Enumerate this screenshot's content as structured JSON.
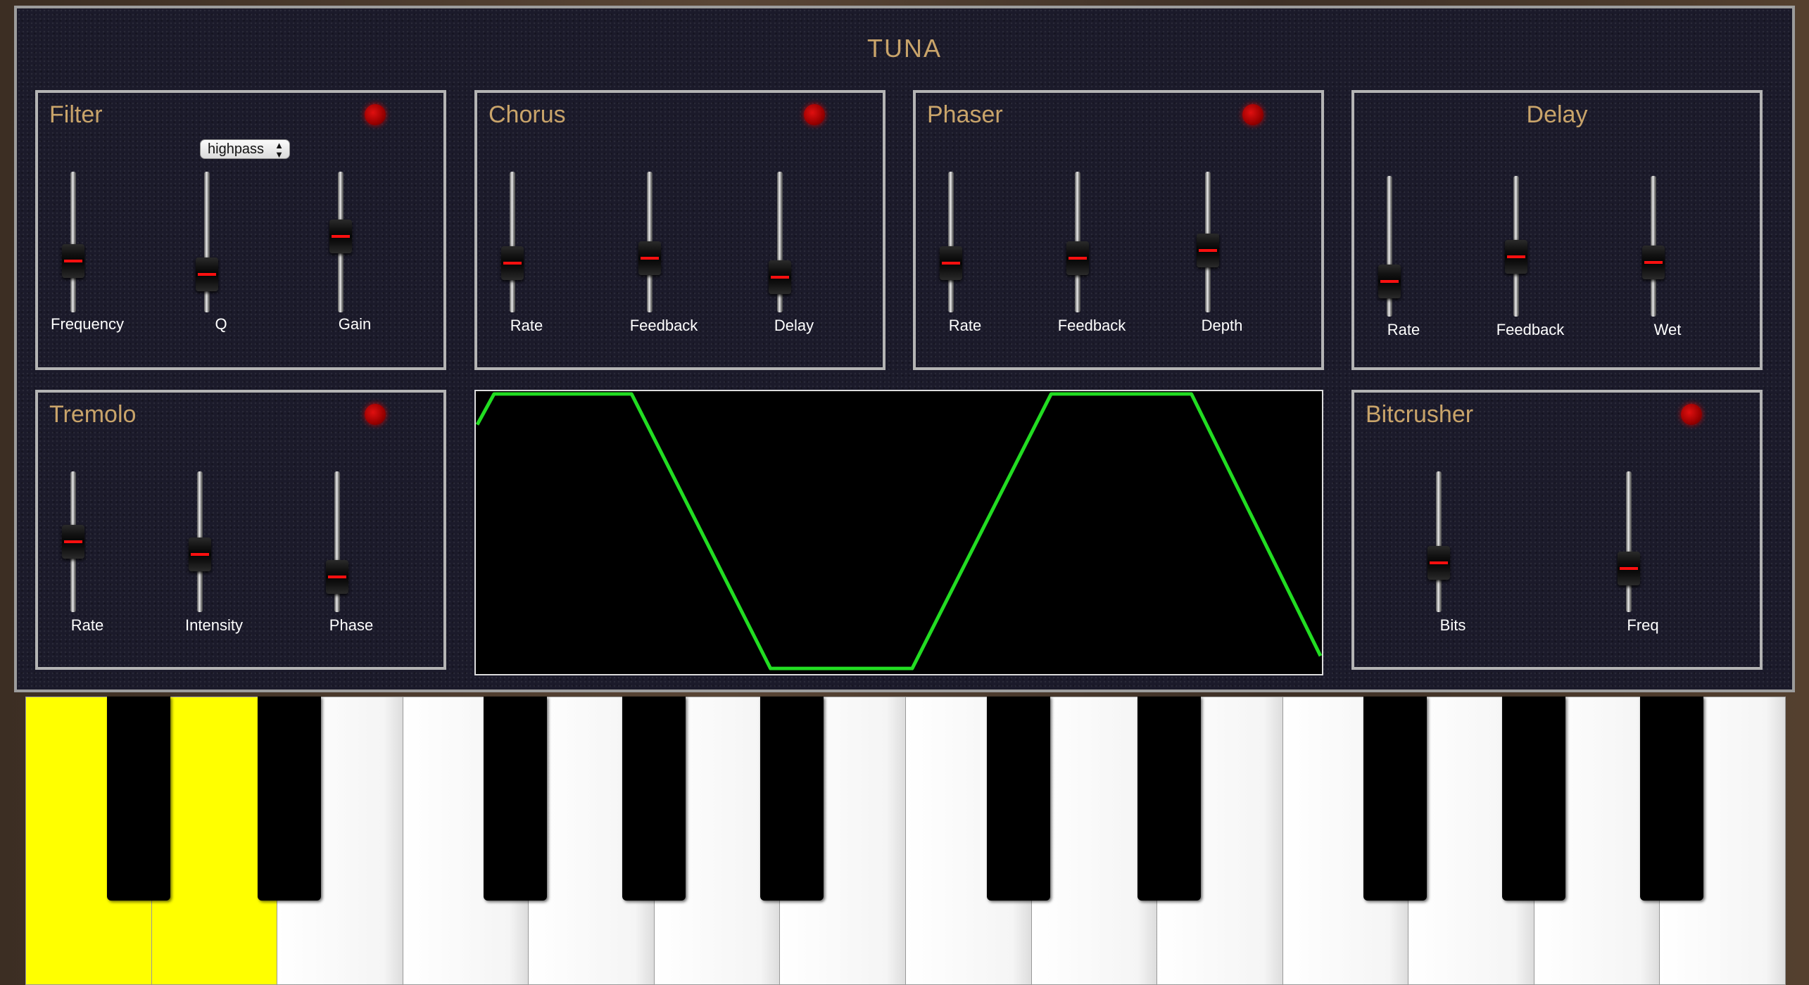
{
  "app": {
    "title": "TUNA"
  },
  "colors": {
    "panel_title": "#c9a46a",
    "led": "#d00000",
    "scope_line": "#22dd22",
    "active_key": "#ffff00"
  },
  "filter": {
    "title": "Filter",
    "type_select": {
      "value": "highpass"
    },
    "sliders": [
      {
        "label": "Frequency",
        "level": 0.32
      },
      {
        "label": "Q",
        "level": 0.2
      },
      {
        "label": "Gain",
        "level": 0.55
      }
    ]
  },
  "chorus": {
    "title": "Chorus",
    "sliders": [
      {
        "label": "Rate",
        "level": 0.3
      },
      {
        "label": "Feedback",
        "level": 0.35
      },
      {
        "label": "Delay",
        "level": 0.17
      }
    ]
  },
  "phaser": {
    "title": "Phaser",
    "sliders": [
      {
        "label": "Rate",
        "level": 0.3
      },
      {
        "label": "Feedback",
        "level": 0.35
      },
      {
        "label": "Depth",
        "level": 0.42
      }
    ]
  },
  "delay": {
    "title": "Delay",
    "sliders": [
      {
        "label": "Rate",
        "level": 0.17
      },
      {
        "label": "Feedback",
        "level": 0.4
      },
      {
        "label": "Wet",
        "level": 0.35
      }
    ]
  },
  "tremolo": {
    "title": "Tremolo",
    "sliders": [
      {
        "label": "Rate",
        "level": 0.5
      },
      {
        "label": "Intensity",
        "level": 0.38
      },
      {
        "label": "Phase",
        "level": 0.17
      }
    ]
  },
  "bitcrusher": {
    "title": "Bitcrusher",
    "sliders": [
      {
        "label": "Bits",
        "level": 0.3
      },
      {
        "label": "Freq",
        "level": 0.25
      }
    ]
  },
  "keyboard": {
    "white_keys": 14,
    "active_white_keys": [
      0,
      1
    ]
  }
}
